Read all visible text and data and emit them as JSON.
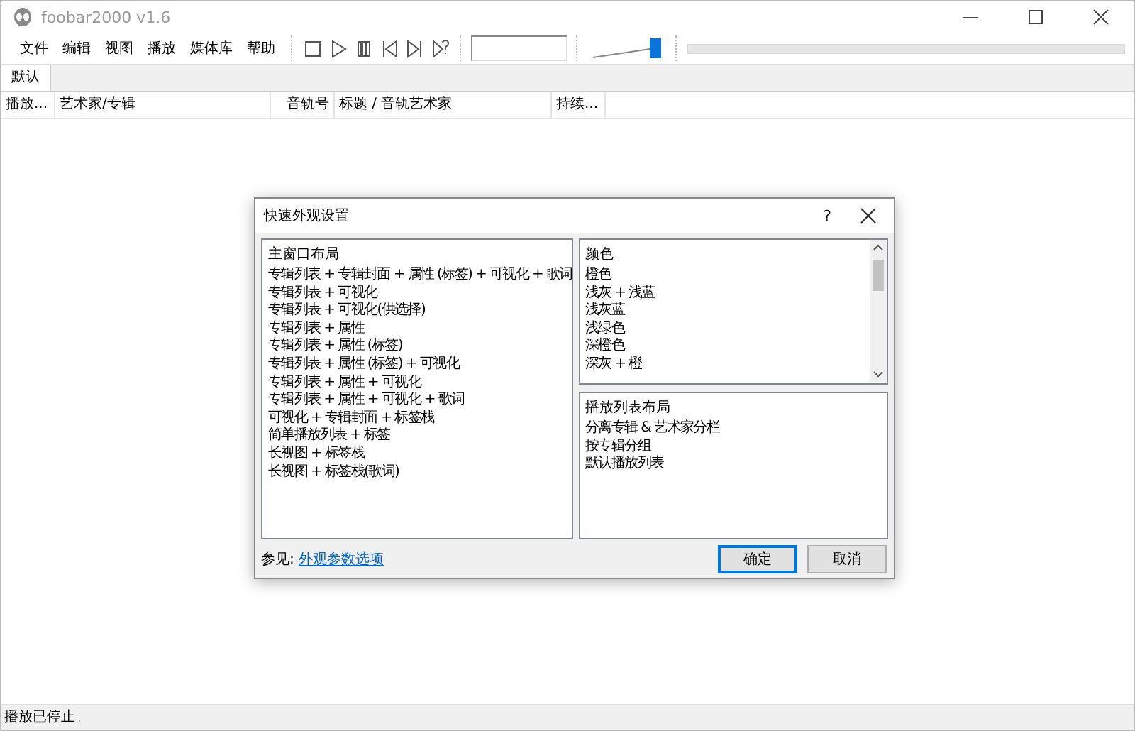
{
  "window": {
    "title": "foobar2000 v1.6"
  },
  "menu": [
    "文件",
    "编辑",
    "视图",
    "播放",
    "媒体库",
    "帮助"
  ],
  "volume": {
    "level": 1
  },
  "tabs": [
    {
      "label": "默认",
      "selected": true
    }
  ],
  "columns": [
    "播放...",
    "艺术家/专辑",
    "音轨号",
    "标题 / 音轨艺术家",
    "持续..."
  ],
  "dialog": {
    "title": "快速外观设置",
    "help": "?",
    "main_layout": {
      "heading": "主窗口布局",
      "items": [
        "专辑列表 + 专辑封面 + 属性 (标签) + 可视化 + 歌词",
        "专辑列表 + 可视化",
        "专辑列表 + 可视化(供选择)",
        "专辑列表 + 属性",
        "专辑列表 + 属性 (标签)",
        "专辑列表 + 属性 (标签) + 可视化",
        "专辑列表 + 属性 + 可视化",
        "专辑列表 + 属性 + 可视化 + 歌词",
        "可视化 + 专辑封面 + 标签栈",
        "简单播放列表 + 标签",
        "长视图 + 标签栈",
        "长视图 + 标签栈(歌词)"
      ]
    },
    "colors": {
      "heading": "颜色",
      "items": [
        "橙色",
        "浅灰 + 浅蓝",
        "浅灰蓝",
        "浅绿色",
        "深橙色",
        "深灰 + 橙"
      ]
    },
    "playlist_layout": {
      "heading": "播放列表布局",
      "items": [
        "分离专辑 & 艺术家分栏",
        "按专辑分组",
        "默认播放列表"
      ]
    },
    "see_also": {
      "label": "参见:",
      "link": "外观参数选项"
    },
    "buttons": [
      {
        "label": "确定",
        "default": true
      },
      {
        "label": "取消",
        "default": false
      }
    ]
  },
  "status_bar": "播放已停止。"
}
